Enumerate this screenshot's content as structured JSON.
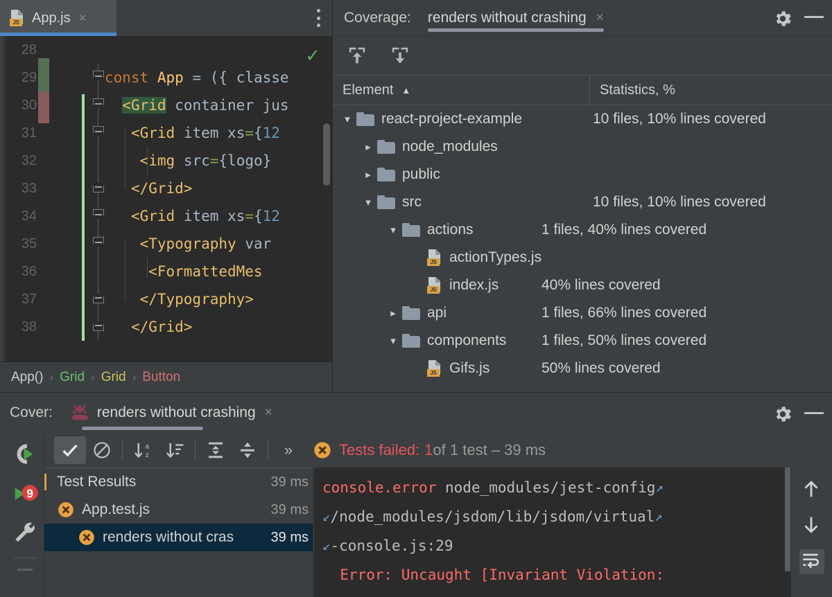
{
  "editor": {
    "tab": {
      "filename": "App.js",
      "icon": "js-file-icon",
      "close": "×",
      "menu_icon": "more-vertical-icon"
    },
    "inspection_ok_icon": "checkmark-ok-icon",
    "lines": [
      {
        "no": "28",
        "code": "",
        "coverage": "none",
        "fold": "none",
        "modified": false
      },
      {
        "no": "29",
        "code": "const App = ({ classe",
        "coverage": "covered",
        "fold": "down",
        "modified": false
      },
      {
        "no": "30",
        "code": "<Grid container jus",
        "coverage": "uncovered",
        "fold": "down",
        "modified": true
      },
      {
        "no": "31",
        "code": "<Grid item xs={12",
        "coverage": "none",
        "fold": "down",
        "modified": true
      },
      {
        "no": "32",
        "code": "<img src={logo}",
        "coverage": "none",
        "fold": "none",
        "modified": true
      },
      {
        "no": "33",
        "code": "</Grid>",
        "coverage": "none",
        "fold": "up",
        "modified": true
      },
      {
        "no": "34",
        "code": "<Grid item xs={12",
        "coverage": "none",
        "fold": "down",
        "modified": true
      },
      {
        "no": "35",
        "code": "<Typography var",
        "coverage": "none",
        "fold": "down",
        "modified": true
      },
      {
        "no": "36",
        "code": "<FormattedMes",
        "coverage": "none",
        "fold": "none",
        "modified": true
      },
      {
        "no": "37",
        "code": "</Typography>",
        "coverage": "none",
        "fold": "up",
        "modified": true
      },
      {
        "no": "38",
        "code": "</Grid>",
        "coverage": "none",
        "fold": "up",
        "modified": true
      }
    ],
    "breadcrumb": [
      {
        "label": "App()",
        "color": "#cfcfcf"
      },
      {
        "label": "Grid",
        "color": "#6cbf6c"
      },
      {
        "label": "Grid",
        "color": "#c5c258"
      },
      {
        "label": "Button",
        "color": "#d1706f"
      }
    ],
    "breadcrumb_separator": "›"
  },
  "coverage": {
    "label": "Coverage:",
    "tab_title": "renders without crashing",
    "tab_close": "×",
    "settings_icon": "gear-icon",
    "minimize_icon": "minimize-icon",
    "toolbar": [
      {
        "name": "export-coverage-icon",
        "tooltip": "Export"
      },
      {
        "name": "import-coverage-icon",
        "tooltip": "Import"
      }
    ],
    "columns": {
      "element": "Element",
      "statistics": "Statistics, %",
      "sort_indicator": "▲"
    },
    "rows": [
      {
        "indent": 0,
        "twisty": "expanded",
        "icon": "folder",
        "name": "react-project-example",
        "stat": "10 files, 10% lines covered"
      },
      {
        "indent": 1,
        "twisty": "collapsed",
        "icon": "folder",
        "name": "node_modules",
        "stat": ""
      },
      {
        "indent": 1,
        "twisty": "collapsed",
        "icon": "folder",
        "name": "public",
        "stat": ""
      },
      {
        "indent": 1,
        "twisty": "expanded",
        "icon": "folder",
        "name": "src",
        "stat": "10 files, 10% lines covered"
      },
      {
        "indent": 2,
        "twisty": "expanded",
        "icon": "folder",
        "name": "actions",
        "stat": "1 files, 40% lines covered"
      },
      {
        "indent": 3,
        "twisty": "none",
        "icon": "js",
        "name": "actionTypes.js",
        "stat": ""
      },
      {
        "indent": 3,
        "twisty": "none",
        "icon": "js",
        "name": "index.js",
        "stat": "40% lines covered"
      },
      {
        "indent": 2,
        "twisty": "collapsed",
        "icon": "folder",
        "name": "api",
        "stat": "1 files, 66% lines covered"
      },
      {
        "indent": 2,
        "twisty": "expanded",
        "icon": "folder",
        "name": "components",
        "stat": "1 files, 50% lines covered"
      },
      {
        "indent": 3,
        "twisty": "none",
        "icon": "js",
        "name": "Gifs.js",
        "stat": "50% lines covered"
      }
    ]
  },
  "cover_bar": {
    "label": "Cover:",
    "tab_title": "renders without crashing",
    "tab_icon": "jest-icon",
    "tab_close": "×",
    "settings_icon": "gear-icon",
    "minimize_icon": "minimize-icon"
  },
  "runner": {
    "side_icons": [
      {
        "name": "rerun-coverage-icon"
      },
      {
        "name": "rerun-failed-tests-icon"
      },
      {
        "name": "settings-wrench-icon"
      },
      {
        "name": "stop-process-icon"
      }
    ],
    "toolbar": [
      {
        "name": "show-passed-toggle",
        "glyph": "✓",
        "selected": true
      },
      {
        "name": "show-ignored-toggle",
        "glyph": "⊘",
        "selected": false
      },
      {
        "name": "sort-alphabetically-icon",
        "glyph": "az",
        "selected": false
      },
      {
        "name": "sort-by-duration-icon",
        "glyph": "dur",
        "selected": false
      },
      {
        "name": "expand-all-icon",
        "glyph": "expand",
        "selected": false
      },
      {
        "name": "collapse-all-icon",
        "glyph": "collapse",
        "selected": false
      },
      {
        "name": "more-options-icon",
        "glyph": "»",
        "selected": false
      }
    ],
    "status": {
      "icon": "test-failed-icon",
      "failed_prefix": "Tests failed:",
      "failed_count": "1",
      "rest": " of 1 test – 39 ms"
    },
    "results": [
      {
        "indent": 0,
        "icon": "none",
        "label": "Test Results",
        "time": "39 ms",
        "selected": false
      },
      {
        "indent": 0,
        "icon": "failed",
        "label": "App.test.js",
        "time": "39 ms",
        "selected": false
      },
      {
        "indent": 1,
        "icon": "failed",
        "label": "renders without cras",
        "time": "39 ms",
        "selected": true
      }
    ],
    "console": [
      {
        "parts": [
          {
            "t": "console.error",
            "c": "red"
          },
          {
            "t": " node_modules/jest-config",
            "c": "gray"
          },
          {
            "t": "↗",
            "c": "wrap"
          }
        ]
      },
      {
        "parts": [
          {
            "t": "↙",
            "c": "wrap"
          },
          {
            "t": "/node_modules/jsdom/lib/jsdom/virtual",
            "c": "gray"
          },
          {
            "t": "↗",
            "c": "wrap"
          }
        ]
      },
      {
        "parts": [
          {
            "t": "↙",
            "c": "wrap"
          },
          {
            "t": "-console.js:29",
            "c": "gray"
          }
        ]
      },
      {
        "parts": [
          {
            "t": "  Error: Uncaught [Invariant Violation:",
            "c": "red"
          }
        ]
      }
    ],
    "console_toolbar": [
      {
        "name": "scroll-up-icon",
        "glyph": "↑",
        "selected": false
      },
      {
        "name": "scroll-down-icon",
        "glyph": "↓",
        "selected": false
      },
      {
        "name": "soft-wrap-icon",
        "glyph": "wrap",
        "selected": true
      }
    ]
  },
  "colors": {
    "background": "#3c3f41",
    "editor_bg": "#2b2b2b",
    "accent_blue": "#4a88c7",
    "error_red": "#e2565d",
    "selection_blue": "#0d293e",
    "coverage_green": "#537053",
    "coverage_red": "#8a5b5b"
  }
}
